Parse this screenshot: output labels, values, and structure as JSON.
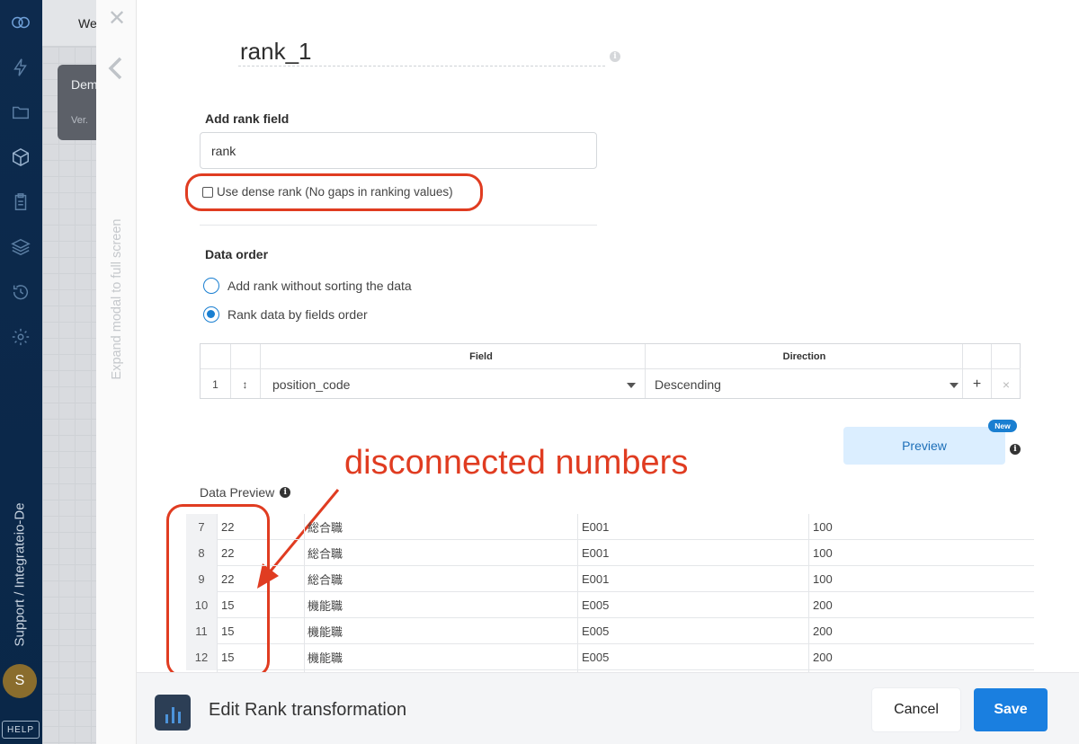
{
  "sidebar": {
    "vertical_text": "Support / Integrateio-De",
    "avatar_initial": "S",
    "help_label": "HELP"
  },
  "background": {
    "tab_text": "We",
    "card_title": "Dem",
    "card_version": "Ver. "
  },
  "modal": {
    "expand_text": "Expand modal to full screen",
    "component_name": "rank_1",
    "add_rank_field": {
      "label": "Add rank field",
      "value": "rank"
    },
    "dense_rank": {
      "label": "Use dense rank (No gaps in ranking values)",
      "checked": false
    },
    "data_order": {
      "label": "Data order",
      "options": [
        {
          "label": "Add rank without sorting the data",
          "selected": false
        },
        {
          "label": "Rank data by fields order",
          "selected": true
        }
      ]
    },
    "order_table": {
      "headers": {
        "field": "Field",
        "direction": "Direction"
      },
      "rows": [
        {
          "index": "1",
          "drag": "↕",
          "field": "position_code",
          "direction": "Descending",
          "add": "+",
          "remove": "×"
        }
      ]
    },
    "preview_button": "Preview",
    "new_badge": "New",
    "data_preview": {
      "label": "Data Preview",
      "rows": [
        {
          "index": "7",
          "rank": "22",
          "col2": "総合職",
          "col3": "E001",
          "col4": "100"
        },
        {
          "index": "8",
          "rank": "22",
          "col2": "総合職",
          "col3": "E001",
          "col4": "100"
        },
        {
          "index": "9",
          "rank": "22",
          "col2": "総合職",
          "col3": "E001",
          "col4": "100"
        },
        {
          "index": "10",
          "rank": "15",
          "col2": "機能職",
          "col3": "E005",
          "col4": "200"
        },
        {
          "index": "11",
          "rank": "15",
          "col2": "機能職",
          "col3": "E005",
          "col4": "200"
        },
        {
          "index": "12",
          "rank": "15",
          "col2": "機能職",
          "col3": "E005",
          "col4": "200"
        }
      ]
    },
    "annotation": "disconnected numbers",
    "footer": {
      "title": "Edit Rank transformation",
      "cancel": "Cancel",
      "save": "Save"
    }
  },
  "colors": {
    "accent": "#1a7fe0",
    "annotation": "#e03c21",
    "rail": "#0d2a4d"
  }
}
